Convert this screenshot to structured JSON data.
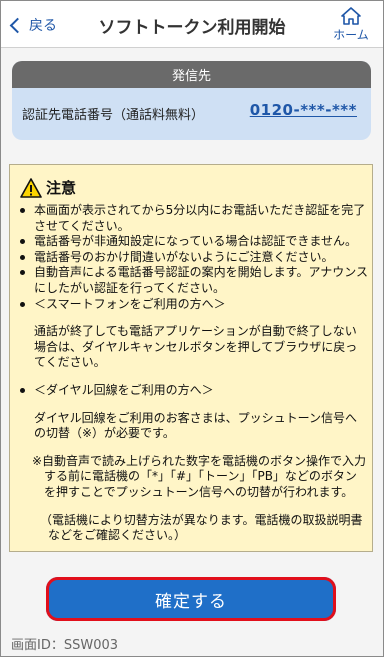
{
  "header": {
    "back_label": "戻る",
    "title": "ソフトトークン利用開始",
    "home_label": "ホーム"
  },
  "destination": {
    "heading": "発信先",
    "label": "認証先電話番号（通話料無料）",
    "phone": "0120-***-***"
  },
  "caution": {
    "heading": "注意",
    "items": [
      "本画面が表示されてから5分以内にお電話いただき認証を完了させてください。",
      "電話番号が非通知設定になっている場合は認証できません。",
      "電話番号のおかけ間違いがないようにご注意ください。",
      "自動音声による電話番号認証の案内を開始します。アナウンスにしたがい認証を行ってください。",
      "＜スマートフォンをご利用の方へ＞",
      "＜ダイヤル回線をご利用の方へ＞"
    ],
    "smartphone_text": "通話が終了しても電話アプリケーションが自動で終了しない場合は、ダイヤルキャンセルボタンを押してブラウザに戻ってください。",
    "dial_text": "ダイヤル回線をご利用のお客さまは、プッシュトーン信号への切替（※）が必要です。",
    "note_text": "※自動音声で読み上げられた数字を電話機のボタン操作で入力する前に電話機の「*」「#」「トーン」「PB」などのボタンを押すことでプッシュトーン信号への切替が行われます。",
    "note_sub": "（電話機により切替方法が異なります。電話機の取扱説明書などをご確認ください。）"
  },
  "confirm_label": "確定する",
  "screen_id": "画面ID：SSW003",
  "colors": {
    "accent": "#1f57a8",
    "button": "#1f6fc8",
    "button_outline": "#e10f1b",
    "caution_bg": "#fff5c7",
    "dest_bg": "#cfe0f4",
    "dest_head_bg": "#6a6a6a"
  }
}
